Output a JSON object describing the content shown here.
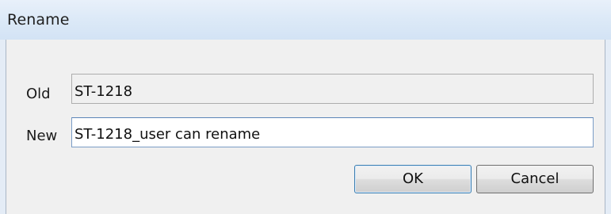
{
  "dialog": {
    "title": "Rename",
    "old_label": "Old",
    "old_value": "ST-1218",
    "new_label": "New",
    "new_value": "ST-1218_user can rename",
    "ok_label": "OK",
    "cancel_label": "Cancel"
  },
  "colors": {
    "titlebar": "#dce9f7",
    "client_background": "#f0f0f0",
    "default_button_border": "#3c7fb1"
  }
}
